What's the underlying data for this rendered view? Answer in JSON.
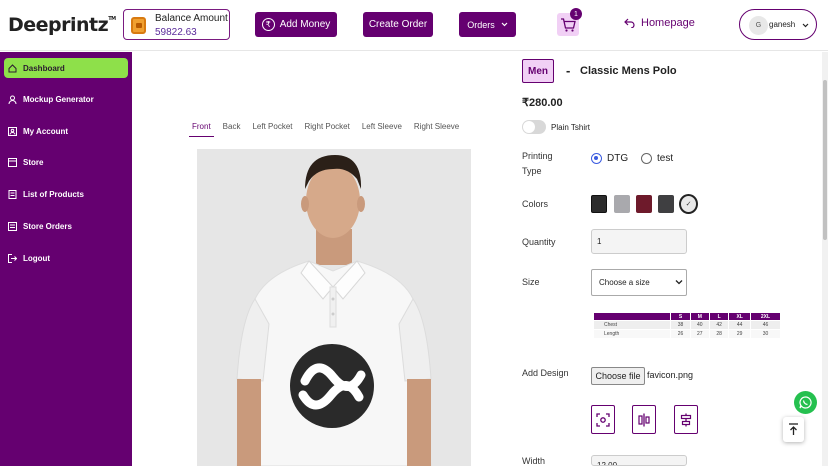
{
  "header": {
    "logo": "Deeprintz",
    "logo_tm": "TM",
    "balance_label": "Balance Amount",
    "balance_value": "59822.63",
    "add_money": "Add Money",
    "create_order": "Create Order",
    "orders": "Orders",
    "cart_count": "1",
    "homepage": "Homepage",
    "user_initial": "G",
    "user_name": "ganesh"
  },
  "sidebar": {
    "items": [
      {
        "label": "Dashboard",
        "icon": "home-icon",
        "active": true
      },
      {
        "label": "Mockup Generator",
        "icon": "user-icon"
      },
      {
        "label": "My Account",
        "icon": "account-icon"
      },
      {
        "label": "Store",
        "icon": "store-icon"
      },
      {
        "label": "List of Products",
        "icon": "list-icon"
      },
      {
        "label": "Store Orders",
        "icon": "orders-icon"
      },
      {
        "label": "Logout",
        "icon": "logout-icon"
      }
    ]
  },
  "preview": {
    "tabs": [
      "Front",
      "Back",
      "Left Pocket",
      "Right Pocket",
      "Left Sleeve",
      "Right Sleeve"
    ],
    "active_tab": "Front"
  },
  "product": {
    "gender": "Men",
    "separator": "-",
    "name": "Classic Mens Polo",
    "price": "₹280.00",
    "plain_label": "Plain Tshirt",
    "printing_label": "Printing Type",
    "printing_options": [
      "DTG",
      "test"
    ],
    "printing_selected": "DTG",
    "colors_label": "Colors",
    "colors": [
      "#2c2c2c",
      "#a9a9ad",
      "#6e1a2b",
      "#3f3f41",
      "#e8e8e8"
    ],
    "quantity_label": "Quantity",
    "quantity_value": "1",
    "size_label": "Size",
    "size_placeholder": "Choose a size",
    "design_label": "Add Design",
    "choose_file": "Choose file",
    "file_name": "favicon.png",
    "width_label": "Width",
    "width_value": "12.00"
  },
  "size_chart": {
    "headers": [
      "",
      "S",
      "M",
      "L",
      "XL",
      "2XL"
    ],
    "rows": [
      [
        "Chest",
        "38",
        "40",
        "42",
        "44",
        "46"
      ],
      [
        "Length",
        "26",
        "27",
        "28",
        "29",
        "30"
      ]
    ]
  }
}
